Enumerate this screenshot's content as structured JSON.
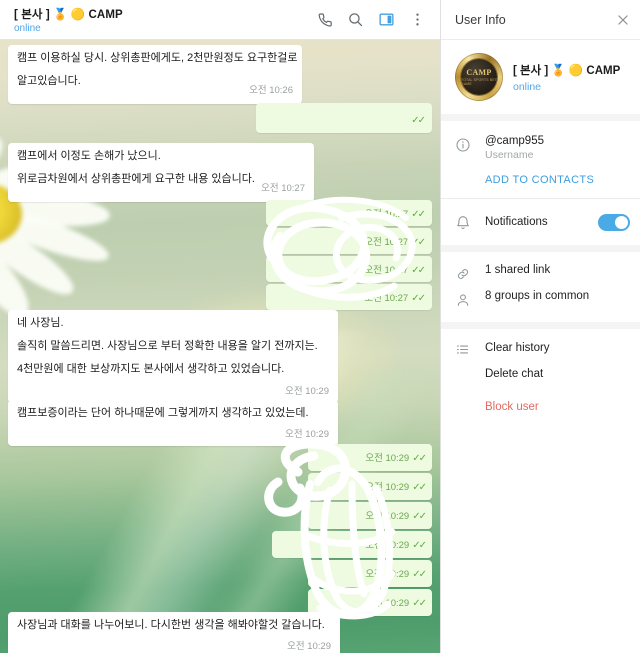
{
  "chat_header": {
    "title": "[ 본사 ] 🏅 🟡 CAMP",
    "status": "online",
    "icons": [
      "phone-icon",
      "search-icon",
      "sidebar-toggle-icon",
      "more-menu-icon"
    ]
  },
  "messages": [
    {
      "id": "m1",
      "direction": "in",
      "lines": [
        "캠프 이용하실 당시. 상위총판에게도, 2천만원정도 요구한걸로",
        "알고있습니다."
      ],
      "time": "오전 10:26",
      "redacted": false
    },
    {
      "id": "m2",
      "direction": "out",
      "lines": [
        ""
      ],
      "time": "",
      "redacted": true
    },
    {
      "id": "m3",
      "direction": "in",
      "lines": [
        "캠프에서 이정도 손해가 났으니.",
        "위로금차원에서 상위총판에게 요구한 내용 있습니다."
      ],
      "time": "오전 10:27",
      "redacted": false
    },
    {
      "id": "m4",
      "direction": "out",
      "lines": [
        ""
      ],
      "time": "오전 10:27",
      "redacted": true
    },
    {
      "id": "m5",
      "direction": "out",
      "lines": [
        ""
      ],
      "time": "오전 10:27",
      "redacted": true
    },
    {
      "id": "m6",
      "direction": "out",
      "lines": [
        ""
      ],
      "time": "오전 10:27",
      "redacted": true
    },
    {
      "id": "m7",
      "direction": "out",
      "lines": [
        ""
      ],
      "time": "오전 10:27",
      "redacted": true
    },
    {
      "id": "m8",
      "direction": "in",
      "lines": [
        "네 사장님.",
        "솔직히 말씀드리면. 사장님으로 부터 정확한 내용을 알기 전까지는.",
        "4천만원에 대한 보상까지도 본사에서 생각하고 있었습니다."
      ],
      "time": "오전 10:29",
      "redacted": false
    },
    {
      "id": "m9",
      "direction": "in",
      "lines": [
        "캠프보증이라는 단어 하나때문에 그렇게까지 생각하고 있었는데."
      ],
      "time": "오전 10:29",
      "redacted": false
    },
    {
      "id": "m10",
      "direction": "out",
      "lines": [
        ""
      ],
      "time": "오전 10:29",
      "redacted": true
    },
    {
      "id": "m11",
      "direction": "out",
      "lines": [
        ""
      ],
      "time": "오전 10:29",
      "redacted": true
    },
    {
      "id": "m12",
      "direction": "out",
      "lines": [
        ""
      ],
      "time": "오전 10:29",
      "redacted": true
    },
    {
      "id": "m13",
      "direction": "out",
      "lines": [
        ""
      ],
      "time": "오전 10:29",
      "redacted": true
    },
    {
      "id": "m14",
      "direction": "out",
      "lines": [
        ""
      ],
      "time": "오전 10:29",
      "redacted": true
    },
    {
      "id": "m15",
      "direction": "out",
      "lines": [
        ""
      ],
      "time": "오전 10:29",
      "redacted": true
    },
    {
      "id": "m16",
      "direction": "in",
      "lines": [
        "사장님과 대화를 나누어보니. 다시한번 생각을 해봐야할것 갈습니다."
      ],
      "time": "오전 10:29",
      "redacted": false
    }
  ],
  "read_receipt": "✓✓",
  "info_panel": {
    "title": "User Info",
    "close_icon": "close-icon",
    "profile": {
      "avatar_word": "CAMP",
      "avatar_sub": "TOTAL SPORTS BET GAME",
      "name": "[ 본사 ] 🏅 🟡 CAMP",
      "status": "online"
    },
    "username": {
      "icon": "info-icon",
      "value": "@camp955",
      "label": "Username"
    },
    "add_to_contacts": "ADD TO CONTACTS",
    "notifications": {
      "icon": "bell-icon",
      "label": "Notifications",
      "enabled": true
    },
    "stats": [
      {
        "icon": "link-icon",
        "label": "1 shared link"
      },
      {
        "icon": "person-icon",
        "label": "8 groups in common"
      }
    ],
    "actions_icon": "list-icon",
    "actions": [
      {
        "label": "Clear history",
        "danger": false
      },
      {
        "label": "Delete chat",
        "danger": false
      },
      {
        "label": "Block user",
        "danger": true
      }
    ]
  },
  "colors": {
    "accent_blue": "#49aae6",
    "link_blue": "#3c9fe0",
    "danger_red": "#e36a63",
    "bubble_out": "#eefbe1",
    "bubble_in": "#ffffff",
    "check_green": "#5fae3f"
  }
}
